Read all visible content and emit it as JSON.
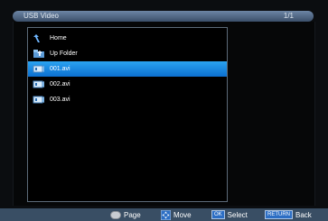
{
  "header": {
    "title": "USB Video",
    "page_indicator": "1/1"
  },
  "file_list": {
    "items": [
      {
        "label": "Home",
        "icon": "home-icon",
        "selected": false
      },
      {
        "label": "Up Folder",
        "icon": "up-folder-icon",
        "selected": false
      },
      {
        "label": "001.avi",
        "icon": "video-file-icon",
        "selected": true
      },
      {
        "label": "002.avi",
        "icon": "video-file-icon",
        "selected": false
      },
      {
        "label": "003.avi",
        "icon": "video-file-icon",
        "selected": false
      }
    ]
  },
  "footer": {
    "page_label": "Page",
    "move_label": "Move",
    "select_key": "OK",
    "select_label": "Select",
    "return_key": "RETURN",
    "back_label": "Back"
  },
  "colors": {
    "selection": "#1e8ae6",
    "footer_bg": "#394e64",
    "panel_border": "#5c6a78"
  }
}
